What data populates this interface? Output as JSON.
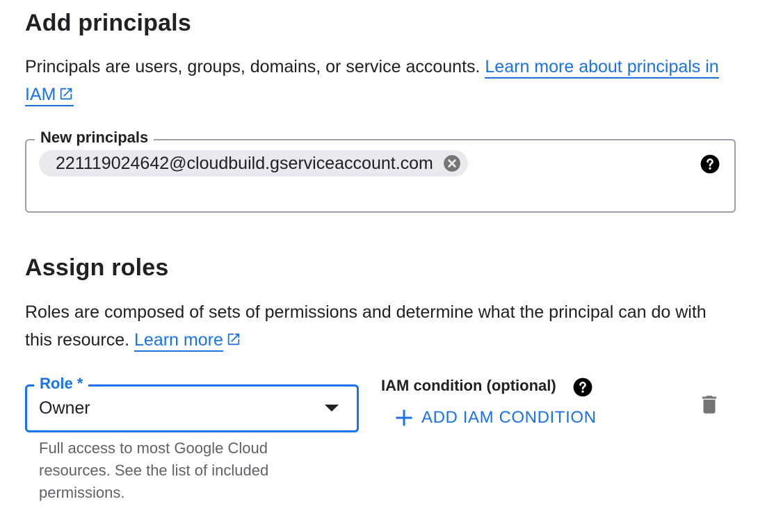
{
  "add_principals": {
    "heading": "Add principals",
    "description": "Principals are users, groups, domains, or service accounts. ",
    "learn_more_link": "Learn more about principals in IAM",
    "field_label": "New principals",
    "chips": [
      "221119024642@cloudbuild.gserviceaccount.com"
    ]
  },
  "assign_roles": {
    "heading": "Assign roles",
    "description": "Roles are composed of sets of permissions and determine what the principal can do with this resource. ",
    "learn_more_link": "Learn more",
    "role_field_label": "Role *",
    "role_value": "Owner",
    "role_description": "Full access to most Google Cloud resources. See the list of included permissions.",
    "iam_condition_label": "IAM condition (optional)",
    "add_condition_button": "ADD IAM CONDITION"
  },
  "icons": {
    "external_link": "external-link-icon",
    "chip_remove": "cancel-circle-icon",
    "help": "help-circle-icon",
    "dropdown": "arrow-drop-down-icon",
    "add": "plus-icon",
    "delete": "trash-icon"
  },
  "colors": {
    "link": "#1a73e8",
    "text": "#202124",
    "secondary_text": "#5f6368",
    "outline": "#9aa0a6",
    "chip_bg": "#e8eaed",
    "icon_grey": "#757575"
  }
}
